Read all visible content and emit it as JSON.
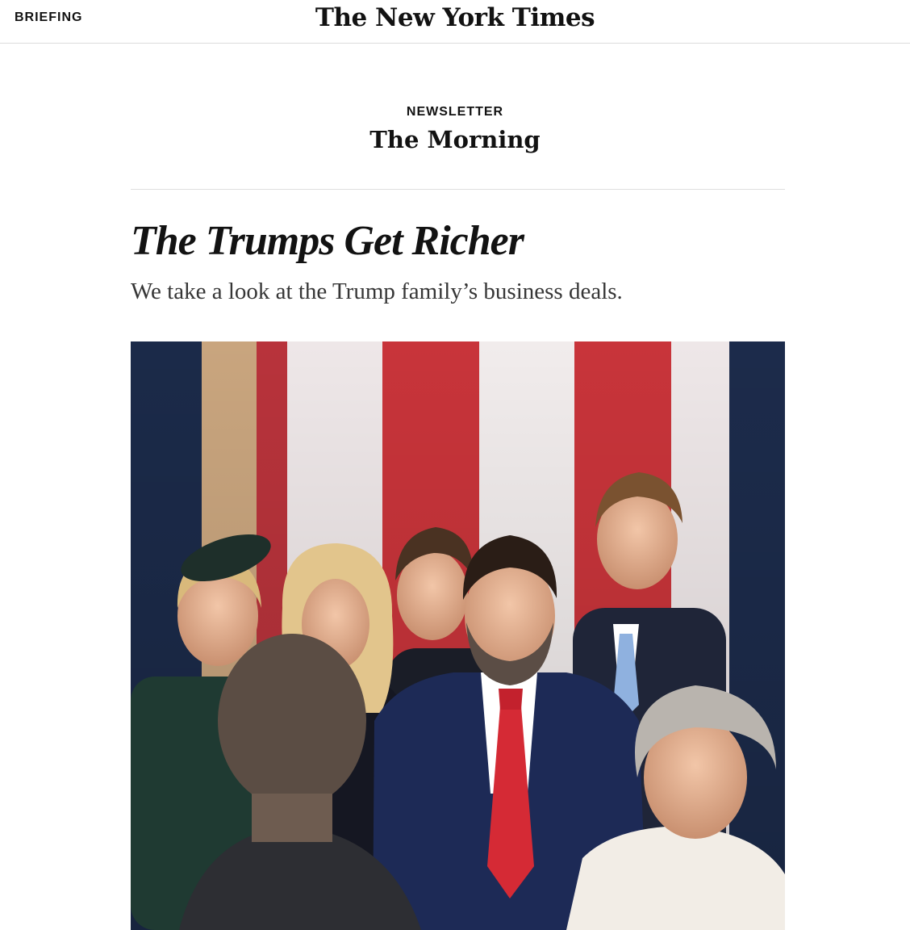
{
  "header": {
    "section_label": "BRIEFING",
    "logo": "The New York Times"
  },
  "newsletter": {
    "kicker": "NEWSLETTER",
    "name": "The Morning"
  },
  "article": {
    "headline": "The Trumps Get Richer",
    "summary": "We take a look at the Trump family’s business deals.",
    "image": {
      "subject": "Trump family members standing in front of a large American flag"
    }
  },
  "colors": {
    "text": "#121212",
    "summary_text": "#363636",
    "rule": "#dfdfdf",
    "flag_red": "#c8343a",
    "flag_white": "#f1ecec",
    "navy": "#1b2a49"
  }
}
